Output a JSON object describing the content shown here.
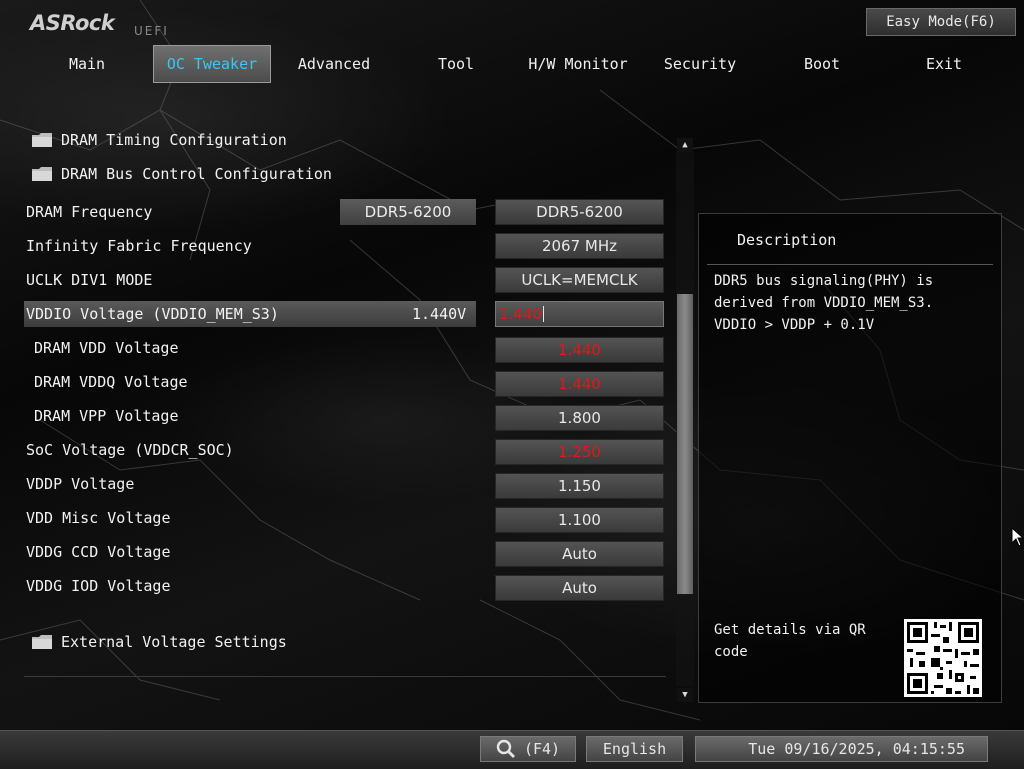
{
  "brand": {
    "logo": "ASRock",
    "sub": "UEFI"
  },
  "easy_mode_label": "Easy Mode(F6)",
  "tabs": [
    {
      "label": "Main"
    },
    {
      "label": "OC Tweaker"
    },
    {
      "label": "Advanced"
    },
    {
      "label": "Tool"
    },
    {
      "label": "H/W Monitor"
    },
    {
      "label": "Security"
    },
    {
      "label": "Boot"
    },
    {
      "label": "Exit"
    }
  ],
  "folders": {
    "timing": "DRAM Timing Configuration",
    "bus": "DRAM Bus Control Configuration",
    "external": "External Voltage Settings"
  },
  "settings": [
    {
      "label": "DRAM Frequency",
      "value": "DDR5-6200",
      "current": "DDR5-6200"
    },
    {
      "label": "Infinity Fabric Frequency",
      "value": "2067 MHz"
    },
    {
      "label": "UCLK DIV1 MODE",
      "value": "UCLK=MEMCLK"
    },
    {
      "label": "VDDIO Voltage (VDDIO_MEM_S3)",
      "value": "1.440",
      "current": "1.440V"
    },
    {
      "label": "DRAM VDD Voltage",
      "value": "1.440"
    },
    {
      "label": "DRAM VDDQ Voltage",
      "value": "1.440"
    },
    {
      "label": "DRAM VPP Voltage",
      "value": "1.800"
    },
    {
      "label": "SoC Voltage (VDDCR_SOC)",
      "value": "1.250"
    },
    {
      "label": "VDDP Voltage",
      "value": "1.150"
    },
    {
      "label": "VDD Misc Voltage",
      "value": "1.100"
    },
    {
      "label": "VDDG CCD Voltage",
      "value": "Auto"
    },
    {
      "label": "VDDG IOD Voltage",
      "value": "Auto"
    }
  ],
  "colors": {
    "active_tab": "#39c6f6",
    "warning_value": "#e01818"
  },
  "description": {
    "title": "Description",
    "text": "DDR5 bus signaling(PHY) is\nderived from VDDIO_MEM_S3.\nVDDIO > VDDP + 0.1V",
    "qr_text": "Get details via QR code"
  },
  "bottom": {
    "search_key": "(F4)",
    "language": "English",
    "datetime": "Tue 09/16/2025, 04:15:55"
  }
}
